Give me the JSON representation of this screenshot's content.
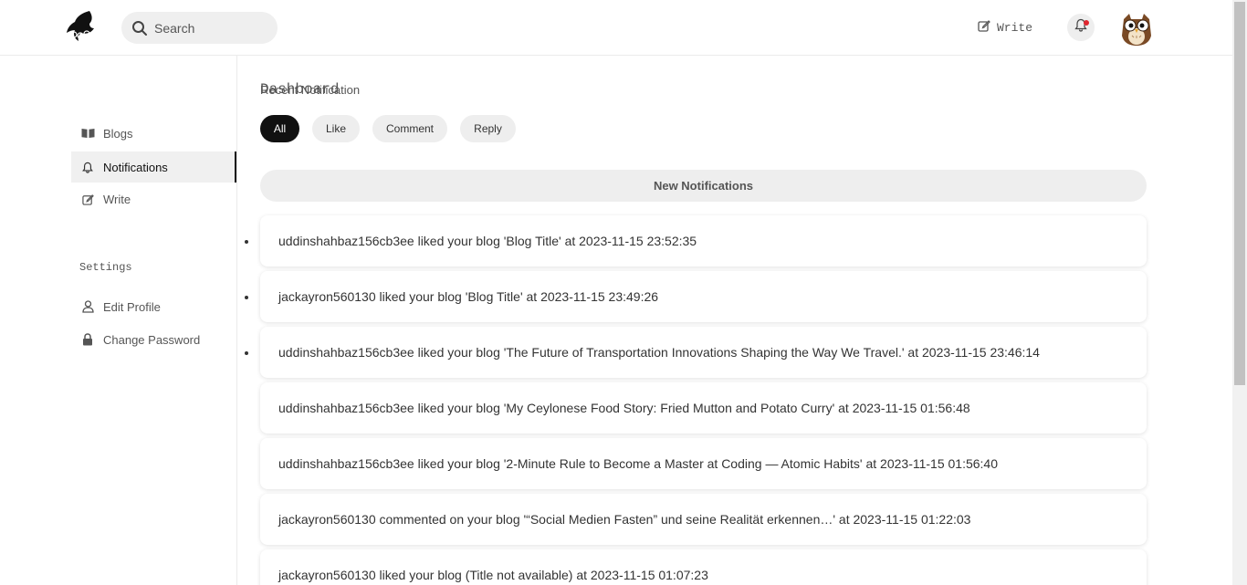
{
  "search": {
    "placeholder": "Search"
  },
  "header": {
    "write_label": "Write"
  },
  "sidebar": {
    "heading": "Dashboard",
    "items": [
      {
        "label": "Blogs",
        "icon": "book-open-icon",
        "active": false
      },
      {
        "label": "Notifications",
        "icon": "bell-icon",
        "active": true
      },
      {
        "label": "Write",
        "icon": "edit-icon",
        "active": false
      }
    ],
    "settings_heading": "Settings",
    "settings_items": [
      {
        "label": "Edit Profile",
        "icon": "user-icon"
      },
      {
        "label": "Change Password",
        "icon": "lock-icon"
      }
    ]
  },
  "main": {
    "title": "Recent Notification",
    "filters": [
      "All",
      "Like",
      "Comment",
      "Reply"
    ],
    "active_filter": "All",
    "new_banner": "New Notifications",
    "notifications": [
      {
        "text": "uddinshahbaz156cb3ee liked your blog 'Blog Title' at 2023-11-15 23:52:35",
        "unread": true
      },
      {
        "text": "jackayron560130 liked your blog 'Blog Title' at 2023-11-15 23:49:26",
        "unread": true
      },
      {
        "text": "uddinshahbaz156cb3ee liked your blog 'The Future of Transportation Innovations Shaping the Way We Travel.' at 2023-11-15 23:46:14",
        "unread": true
      },
      {
        "text": "uddinshahbaz156cb3ee liked your blog 'My Ceylonese Food Story: Fried Mutton and Potato Curry' at 2023-11-15 01:56:48",
        "unread": false
      },
      {
        "text": "uddinshahbaz156cb3ee liked your blog '2-Minute Rule to Become a Master at Coding — Atomic Habits' at 2023-11-15 01:56:40",
        "unread": false
      },
      {
        "text": "jackayron560130 commented on your blog '“Social Medien Fasten” und seine Realität erkennen…' at 2023-11-15 01:22:03",
        "unread": false
      },
      {
        "text": "jackayron560130 liked your blog (Title not available) at 2023-11-15 01:07:23",
        "unread": false
      }
    ]
  },
  "colors": {
    "accent": "#111111",
    "notification_dot": "#e0262f",
    "pill_bg": "#eeeeee"
  }
}
